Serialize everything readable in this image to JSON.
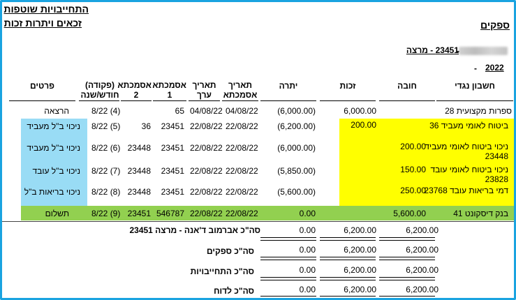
{
  "report": {
    "title": "התחייבויות שוטפות",
    "subtitle": "זכאים ויתרות זכות",
    "section": "ספקים",
    "supplier_label": "23451 - מרצה",
    "dash": "-",
    "year": "2022"
  },
  "columns": {
    "account": "חשבון נגדי",
    "debit": "חובה",
    "credit": "זכות",
    "balance": "יתרה",
    "doc_date": "תאריך אסמכתא",
    "value_date": "תאריך ערך",
    "ref1": "אסמכתא 1",
    "ref2": "אסמכתא 2",
    "period": "(פקודה) חודש/שנה",
    "details": "פרטים"
  },
  "rows": [
    {
      "account": "ספרות מקצועית  28",
      "debit": "",
      "credit": "6,000.00",
      "balance": "(6,000.00)",
      "doc_date": "04/08/22",
      "value_date": "04/08/22",
      "ref1": "65",
      "ref2": "",
      "period": "8/22  (4)",
      "details": "הרצאה"
    },
    {
      "account": "ביטוח לאומי מעביד 36",
      "debit": "200.00",
      "credit": "",
      "balance": "(6,200.00)",
      "doc_date": "22/08/22",
      "value_date": "22/08/22",
      "ref1": "23451",
      "ref2": "36",
      "period": "8/22  (5)",
      "details": "ניכוי ב\"ל מעביד"
    },
    {
      "account": "ניכוי ביטוח לאומי מעביד  23448",
      "debit": "200.00",
      "credit": "",
      "balance": "(6,000.00)",
      "doc_date": "22/08/22",
      "value_date": "22/08/22",
      "ref1": "23451",
      "ref2": "23448",
      "period": "8/22  (6)",
      "details": "ניכוי ב\"ל מעביד"
    },
    {
      "account": "ניכוי ביטוח לאומי עובד  23828",
      "debit": "150.00",
      "credit": "",
      "balance": "(5,850.00)",
      "doc_date": "22/08/22",
      "value_date": "22/08/22",
      "ref1": "23451",
      "ref2": "23448",
      "period": "8/22  (7)",
      "details": "ניכוי ב\"ל עובד"
    },
    {
      "account": "דמי בריאות עובד 23768",
      "debit": "250.00",
      "credit": "",
      "balance": "(5,600.00)",
      "doc_date": "22/08/22",
      "value_date": "22/08/22",
      "ref1": "23451",
      "ref2": "23448",
      "period": "8/22  (8)",
      "details": "ניכוי בריאות ב\"ל"
    },
    {
      "account": "בנק דיסקונט  41",
      "debit": "5,600.00",
      "credit": "",
      "balance": "0.00",
      "doc_date": "22/08/22",
      "value_date": "22/08/22",
      "ref1": "546787",
      "ref2": "23451",
      "period": "8/22  (9)",
      "details": "תשלום"
    }
  ],
  "totals": [
    {
      "label": "סה\"כ אברמוב ד'אנה - מרצה   23451",
      "debit": "6,200.00",
      "credit": "6,200.00",
      "balance": "0.00"
    },
    {
      "label": "סה\"כ ספקים",
      "debit": "6,200.00",
      "credit": "6,200.00",
      "balance": "0.00"
    },
    {
      "label": "סה\"כ התחייבויות",
      "debit": "6,200.00",
      "credit": "6,200.00",
      "balance": "0.00"
    },
    {
      "label": "סה\"כ לדוח",
      "debit": "6,200.00",
      "credit": "6,200.00",
      "balance": "0.00"
    }
  ],
  "colors": {
    "frame": "#1aa3e0",
    "highlight_yellow": "#ffff00",
    "highlight_blue": "#99dcf5",
    "highlight_green": "#92d050"
  }
}
